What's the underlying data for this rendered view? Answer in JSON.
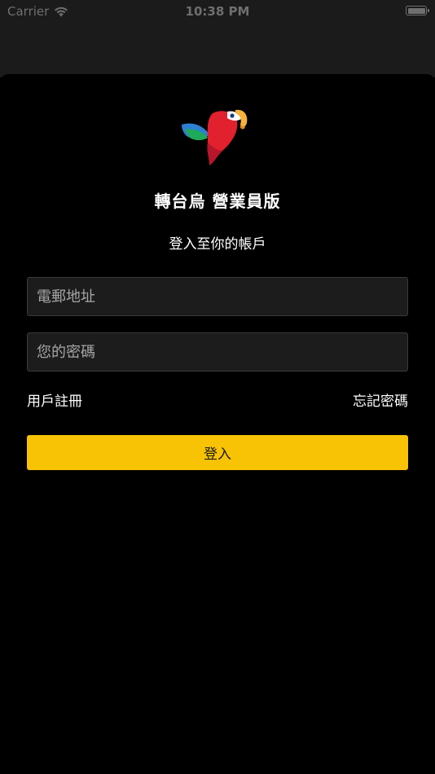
{
  "status_bar": {
    "carrier": "Carrier",
    "time": "10:38 PM",
    "wifi_icon": "wifi-icon",
    "battery_icon": "battery-icon"
  },
  "app": {
    "logo_icon": "parrot-logo-icon",
    "title": "轉台烏 營業員版",
    "subtitle": "登入至你的帳戶"
  },
  "form": {
    "email_placeholder": "電郵地址",
    "email_value": "",
    "password_placeholder": "您的密碼",
    "password_value": "",
    "register_label": "用戶註冊",
    "forgot_label": "忘記密碼",
    "login_label": "登入"
  },
  "colors": {
    "accent": "#f8c304",
    "background": "#000000",
    "field_background": "#1c1c1c"
  }
}
